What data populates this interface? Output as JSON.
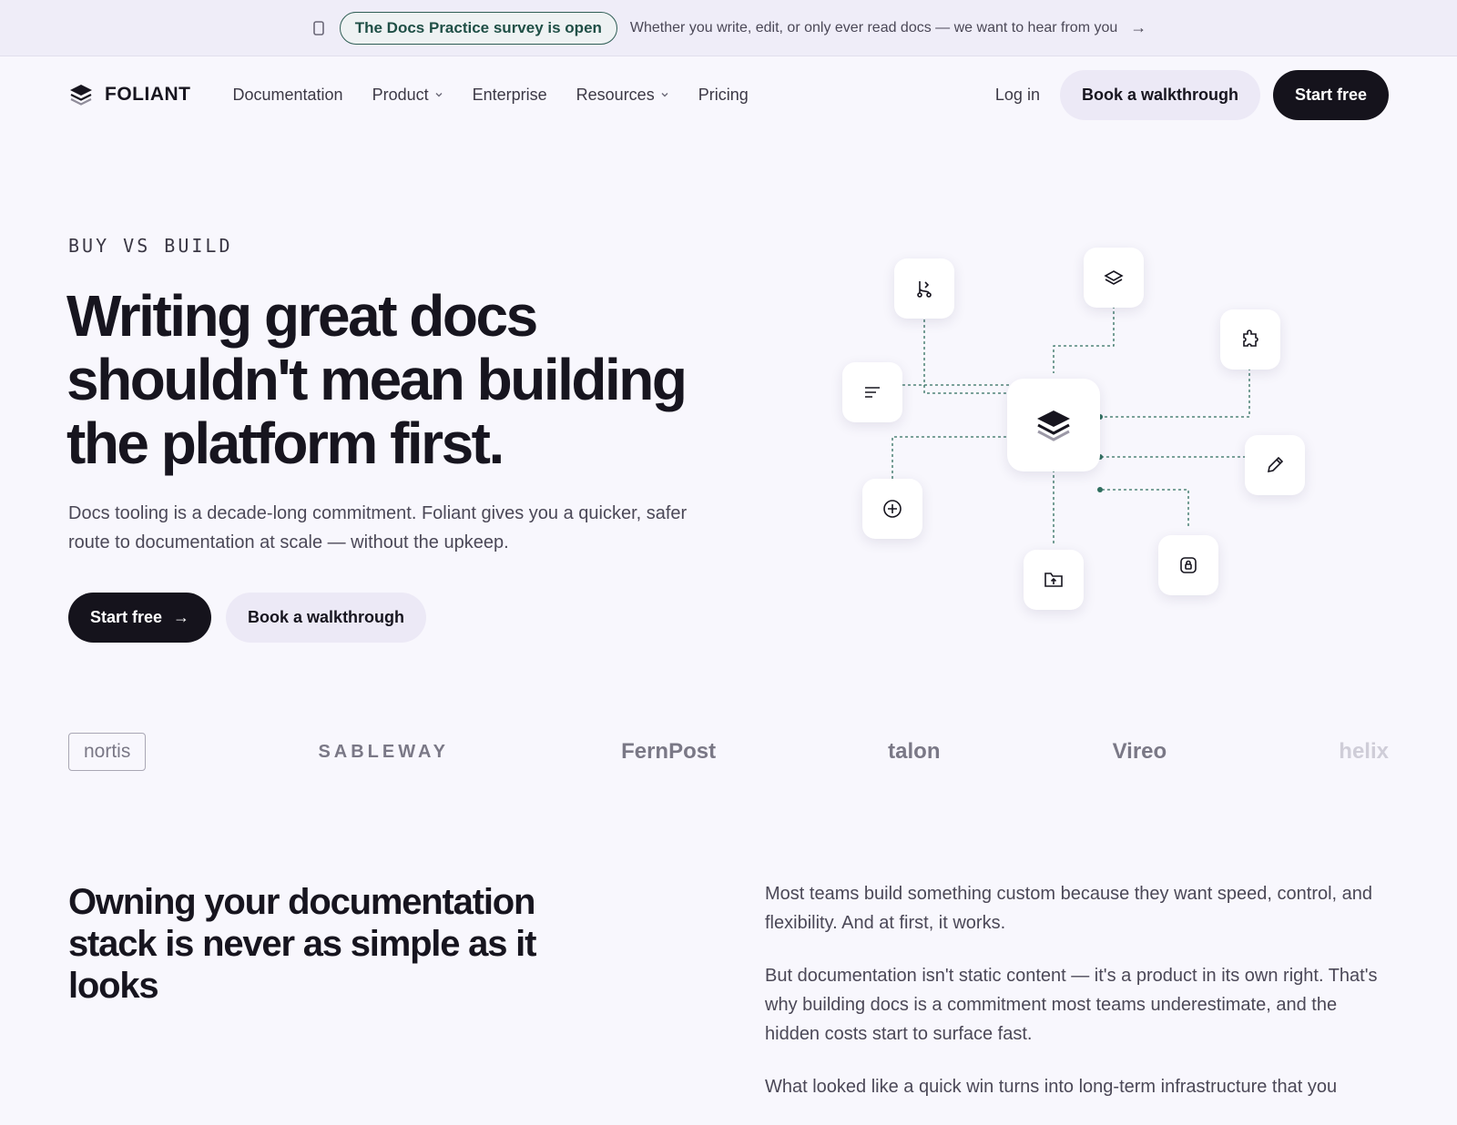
{
  "announcement": {
    "pill": "The Docs Practice survey is open",
    "text": "Whether you write, edit, or only ever read docs — we want to hear from you",
    "arrow": "→"
  },
  "nav": {
    "brand": "FOLIANT",
    "links": [
      "Documentation",
      "Product",
      "Enterprise",
      "Resources",
      "Pricing"
    ],
    "login": "Log in",
    "walkthrough": "Book a walkthrough",
    "start": "Start free"
  },
  "hero": {
    "eyebrow": "BUY VS BUILD",
    "title": "Writing great docs shouldn't mean building the platform first.",
    "subtitle": "Docs tooling is a decade-long commitment. Foliant gives you a quicker, safer route to documentation at scale — without the upkeep.",
    "cta_primary": "Start free",
    "cta_arrow": "→",
    "cta_secondary": "Book a walkthrough"
  },
  "diagram": {
    "accent": "#2f6e5f",
    "nodes": [
      "git-branch-icon",
      "stack-icon",
      "puzzle-icon",
      "list-icon",
      "layers-center-icon",
      "pencil-icon",
      "plus-circle-icon",
      "folder-upload-icon",
      "lock-icon"
    ]
  },
  "logos": [
    "nortis",
    "SABLEWAY",
    "FernPost",
    "talon",
    "Vireo",
    "helix"
  ],
  "section": {
    "title": "Owning your documentation stack is never as simple as it looks",
    "paragraphs": [
      "Most teams build something custom because they want speed, control, and flexibility. And at first, it works.",
      "But documentation isn't static content — it's a product in its own right. That's why building docs is a commitment most teams underestimate, and the hidden costs start to surface fast.",
      "What looked like a quick win turns into long-term infrastructure that you"
    ]
  }
}
